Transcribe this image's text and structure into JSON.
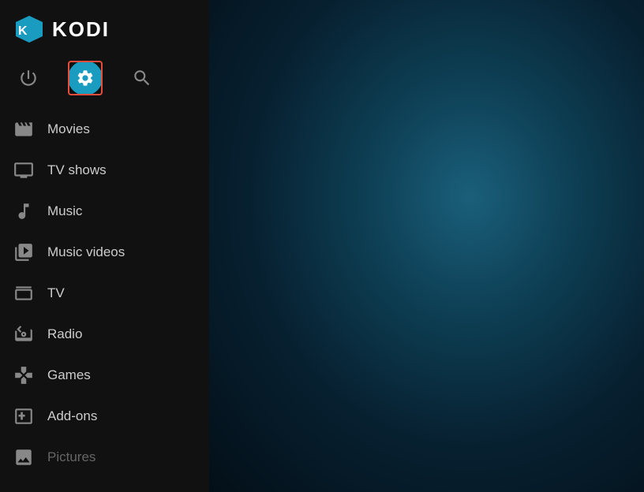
{
  "app": {
    "name": "KODI"
  },
  "top_icons": [
    {
      "id": "power",
      "label": "Power",
      "icon": "power-icon",
      "active": false
    },
    {
      "id": "settings",
      "label": "Settings",
      "icon": "settings-icon",
      "active": true
    },
    {
      "id": "search",
      "label": "Search",
      "icon": "search-icon",
      "active": false
    }
  ],
  "nav_items": [
    {
      "id": "movies",
      "label": "Movies",
      "icon": "movies-icon"
    },
    {
      "id": "tv-shows",
      "label": "TV shows",
      "icon": "tv-shows-icon"
    },
    {
      "id": "music",
      "label": "Music",
      "icon": "music-icon"
    },
    {
      "id": "music-videos",
      "label": "Music videos",
      "icon": "music-videos-icon"
    },
    {
      "id": "tv",
      "label": "TV",
      "icon": "tv-icon"
    },
    {
      "id": "radio",
      "label": "Radio",
      "icon": "radio-icon"
    },
    {
      "id": "games",
      "label": "Games",
      "icon": "games-icon"
    },
    {
      "id": "add-ons",
      "label": "Add-ons",
      "icon": "add-ons-icon"
    },
    {
      "id": "pictures",
      "label": "Pictures",
      "icon": "pictures-icon"
    }
  ]
}
